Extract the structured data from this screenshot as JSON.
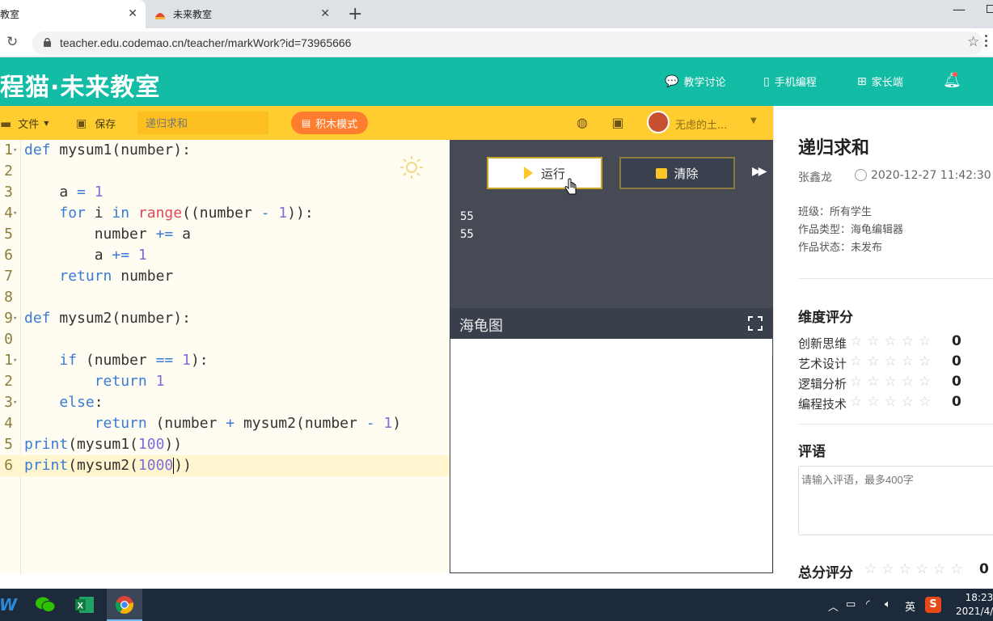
{
  "browser": {
    "tabs": [
      {
        "title": "教室",
        "active": true
      },
      {
        "title": "未来教室",
        "active": false
      }
    ],
    "url": "teacher.edu.codemao.cn/teacher/markWork?id=73965666"
  },
  "header": {
    "brand": "程猫·未来教室",
    "nav": [
      {
        "label": "教学讨论",
        "icon": "chat-icon"
      },
      {
        "label": "手机编程",
        "icon": "phone-icon"
      },
      {
        "label": "家长端",
        "icon": "grid-icon"
      }
    ]
  },
  "toolbar": {
    "file_label": "文件",
    "save_label": "保存",
    "title_placeholder": "递归求和",
    "block_mode_label": "积木模式",
    "username": "无虑的土..."
  },
  "editor": {
    "lines": [
      {
        "n": "1",
        "fold": true
      },
      {
        "n": "2",
        "fold": false
      },
      {
        "n": "3",
        "fold": false
      },
      {
        "n": "4",
        "fold": true
      },
      {
        "n": "5",
        "fold": false
      },
      {
        "n": "6",
        "fold": false
      },
      {
        "n": "7",
        "fold": false
      },
      {
        "n": "8",
        "fold": false
      },
      {
        "n": "9",
        "fold": true
      },
      {
        "n": "0",
        "fold": false
      },
      {
        "n": "1",
        "fold": true
      },
      {
        "n": "2",
        "fold": false
      },
      {
        "n": "3",
        "fold": true
      },
      {
        "n": "4",
        "fold": false
      },
      {
        "n": "5",
        "fold": false
      },
      {
        "n": "6",
        "fold": false
      }
    ],
    "code": [
      "def mysum1(number):",
      "",
      "    a = 1",
      "    for i in range((number - 1)):",
      "        number += a",
      "        a += 1",
      "    return number",
      "",
      "def mysum2(number):",
      "",
      "    if (number == 1):",
      "        return 1",
      "    else:",
      "        return (number + mysum2(number - 1)",
      "print(mysum1(100))",
      "print(mysum2(1000))"
    ]
  },
  "output": {
    "run_label": "运行",
    "clear_label": "清除",
    "lines": [
      "55",
      "55"
    ]
  },
  "turtle": {
    "title": "海龟图"
  },
  "sidebar": {
    "title": "递归求和",
    "author": "张鑫龙",
    "time": "2020-12-27 11:42:30",
    "class": "班级：所有学生",
    "work_type": "作品类型：海龟编辑器",
    "work_status": "作品状态：未发布",
    "dimension_heading": "维度评分",
    "ratings": [
      {
        "label": "创新思维",
        "value": "0"
      },
      {
        "label": "艺术设计",
        "value": "0"
      },
      {
        "label": "逻辑分析",
        "value": "0"
      },
      {
        "label": "编程技术",
        "value": "0"
      }
    ],
    "comment_heading": "评语",
    "comment_placeholder": "请输入评语，最多400字",
    "total_heading": "总分评分",
    "total_value": "0"
  },
  "taskbar": {
    "ime": "英",
    "time": "18:23",
    "date": "2021/4/"
  },
  "colors": {
    "header": "#12bca5",
    "toolbar": "#ffcd30",
    "accent_orange": "#ff7d2e",
    "output_bg": "#454a54"
  }
}
